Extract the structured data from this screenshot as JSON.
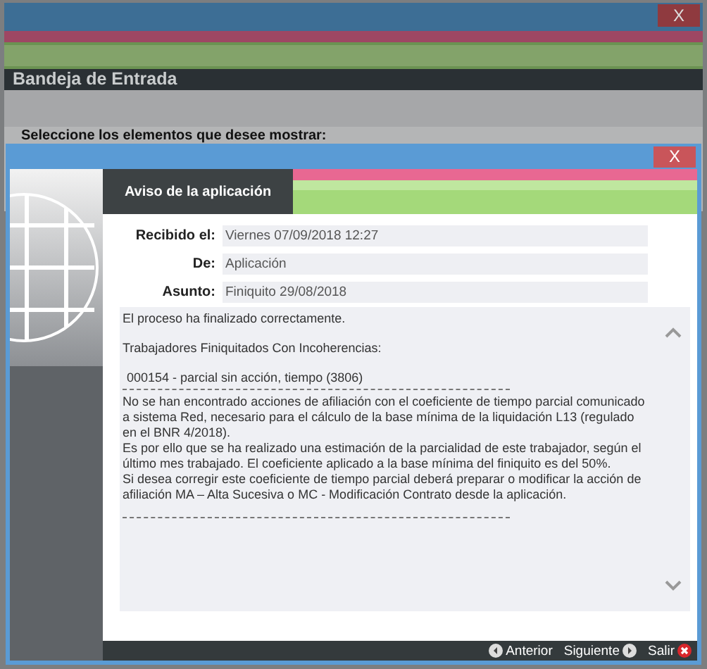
{
  "background_window": {
    "close_button": "X",
    "title": "Bandeja de Entrada",
    "prompt": "Seleccione los elementos que desee mostrar:"
  },
  "dialog": {
    "close_button": "X",
    "tab": "Aviso de la aplicación",
    "fields": [
      {
        "label": "Recibido el:",
        "value": "Viernes 07/09/2018 12:27"
      },
      {
        "label": "De:",
        "value": "Aplicación"
      },
      {
        "label": "Asunto:",
        "value": "Finiquito 29/08/2018"
      }
    ],
    "message": [
      {
        "kind": "text",
        "text": "El proceso ha finalizado correctamente."
      },
      {
        "kind": "text",
        "text": "Trabajadores Finiquitados Con Incoherencias:"
      },
      {
        "kind": "item",
        "text": "000154 - parcial sin acción, tiempo (3806)"
      },
      {
        "kind": "divider"
      },
      {
        "kind": "line",
        "text": "No se han encontrado acciones de afiliación con el coeficiente de tiempo parcial comunicado a sistema Red, necesario para el cálculo de la base mínima de la liquidación L13 (regulado en el BNR 4/2018)."
      },
      {
        "kind": "line",
        "text": "Es por ello que se ha realizado una estimación de la parcialidad de este trabajador, según el último mes trabajado. El coeficiente aplicado a la base mínima del finiquito es del 50%."
      },
      {
        "kind": "line",
        "text": "Si desea corregir este coeficiente de tiempo parcial deberá preparar o modificar la acción de afiliación MA – Alta Sucesiva o MC - Modificación Contrato desde la aplicación."
      },
      {
        "kind": "divider"
      }
    ],
    "buttons": [
      {
        "kind": "previous",
        "label": "Anterior"
      },
      {
        "kind": "next",
        "label": "Siguiente"
      },
      {
        "kind": "exit",
        "label": "Salir"
      }
    ]
  }
}
